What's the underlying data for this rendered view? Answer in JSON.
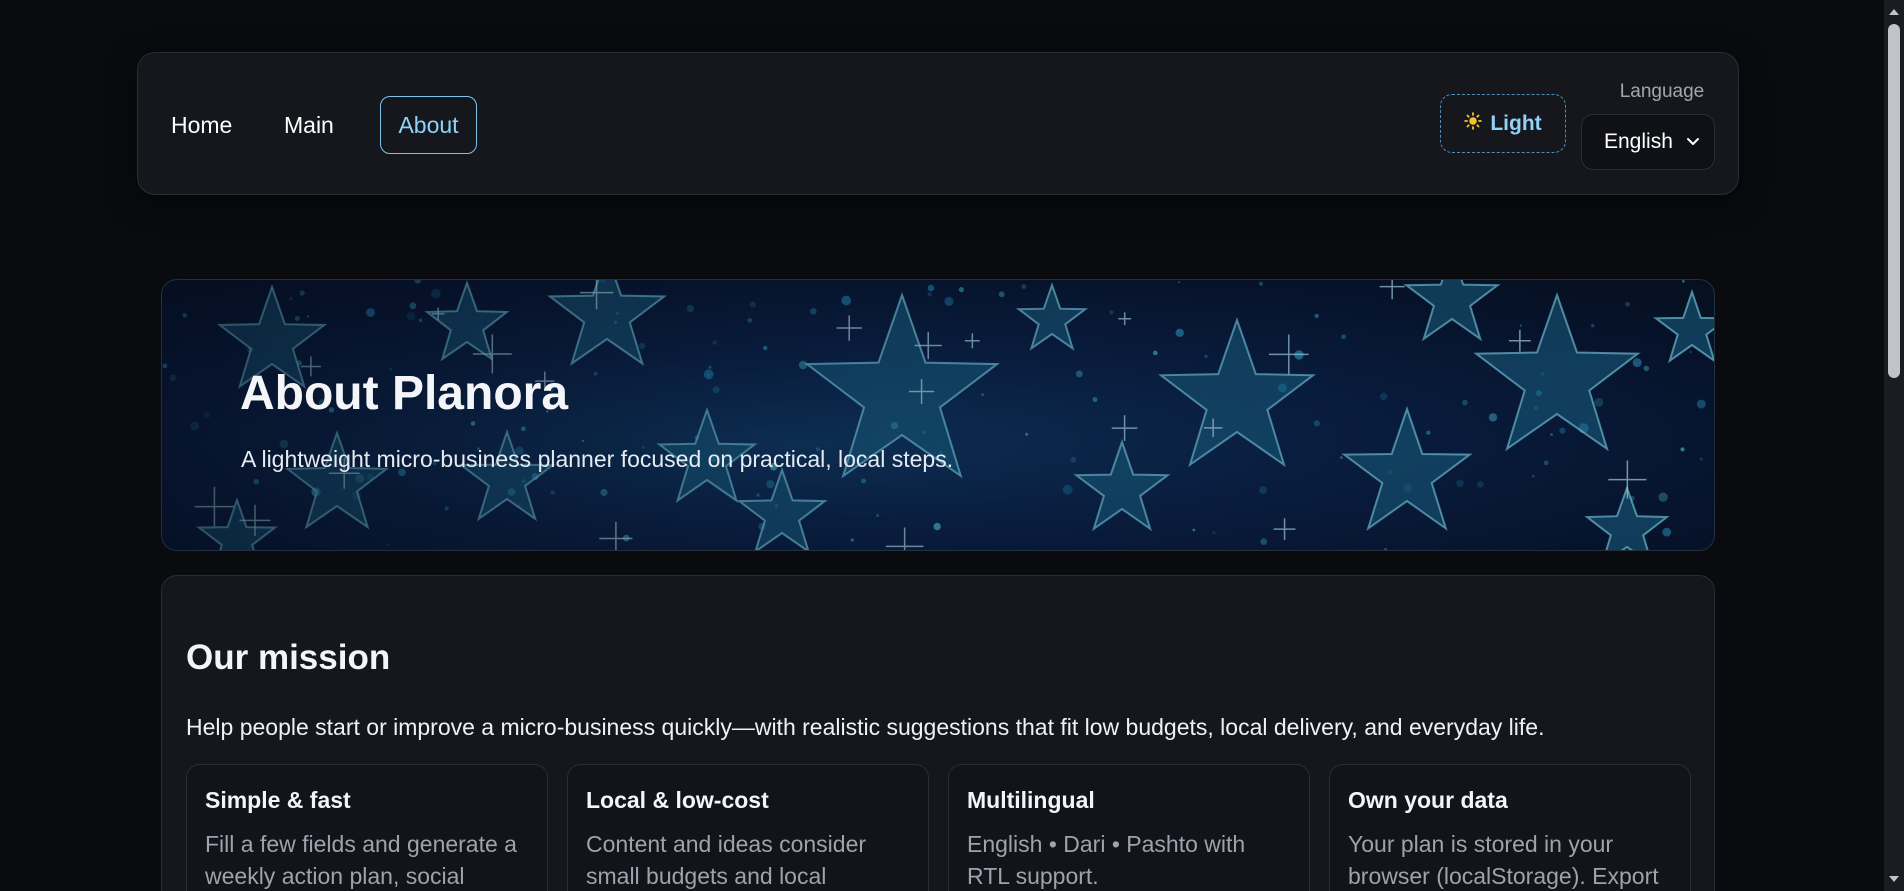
{
  "nav": {
    "links": [
      {
        "label": "Home"
      },
      {
        "label": "Main"
      },
      {
        "label": "About",
        "active": true
      }
    ],
    "theme_button": {
      "icon": "sun-icon",
      "label": "Light"
    },
    "language": {
      "label": "Language",
      "selected": "English"
    }
  },
  "hero": {
    "title": "About Planora",
    "subtitle": "A lightweight micro-business planner focused on practical, local steps."
  },
  "mission": {
    "title": "Our mission",
    "text": "Help people start or improve a micro-business quickly—with realistic suggestions that fit low budgets, local delivery, and everyday life.",
    "cards": [
      {
        "title": "Simple & fast",
        "body": "Fill a few fields and generate a weekly action plan, social"
      },
      {
        "title": "Local & low-cost",
        "body": "Content and ideas consider small budgets and local"
      },
      {
        "title": "Multilingual",
        "body": "English • Dari • Pashto with RTL support."
      },
      {
        "title": "Own your data",
        "body": "Your plan is stored in your browser (localStorage). Export"
      }
    ]
  },
  "colors": {
    "background": "#0a0b0f",
    "panel": "#15171d",
    "accent": "#8fd3f6",
    "sun": "#f4c430"
  }
}
